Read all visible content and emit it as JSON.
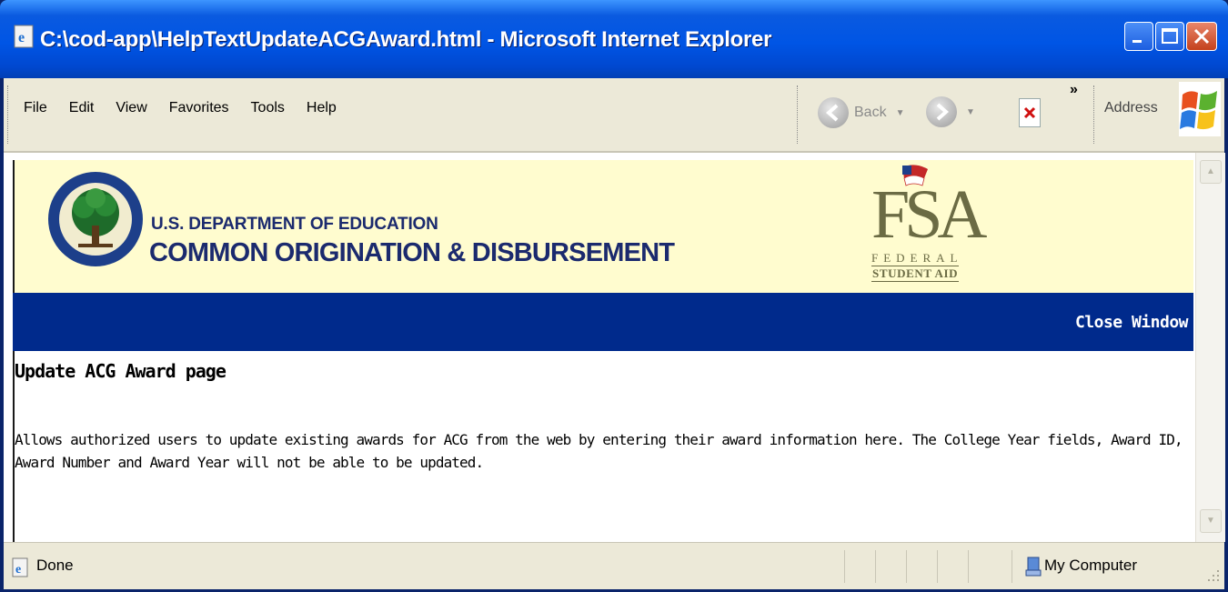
{
  "window": {
    "title": "C:\\cod-app\\HelpTextUpdateACGAward.html - Microsoft Internet Explorer"
  },
  "menubar": {
    "items": [
      {
        "label": "File"
      },
      {
        "label": "Edit"
      },
      {
        "label": "View"
      },
      {
        "label": "Favorites"
      },
      {
        "label": "Tools"
      },
      {
        "label": "Help"
      }
    ]
  },
  "toolbar": {
    "back_label": "Back",
    "chevrons": "»",
    "address_label": "Address"
  },
  "banner": {
    "dept_line1": "U.S. DEPARTMENT OF EDUCATION",
    "dept_line2": "COMMON ORIGINATION & DISBURSEMENT",
    "fsa_letters": "FSA",
    "fsa_federal": "FEDERAL",
    "fsa_student": "STUDENT AID"
  },
  "navbar": {
    "close_label": "Close Window"
  },
  "page": {
    "heading": "Update ACG Award page",
    "description": "Allows authorized users to update existing awards for ACG from the web by entering their award information here. The College Year fields, Award ID, Award Number and Award Year will not be able to be updated."
  },
  "statusbar": {
    "status": "Done",
    "zone": "My Computer"
  },
  "colors": {
    "titlebar": "#0055e5",
    "chrome": "#ece9d8",
    "banner_bg": "#fffccf",
    "navbar": "#002a8c",
    "dept_text": "#1b2a6e"
  }
}
